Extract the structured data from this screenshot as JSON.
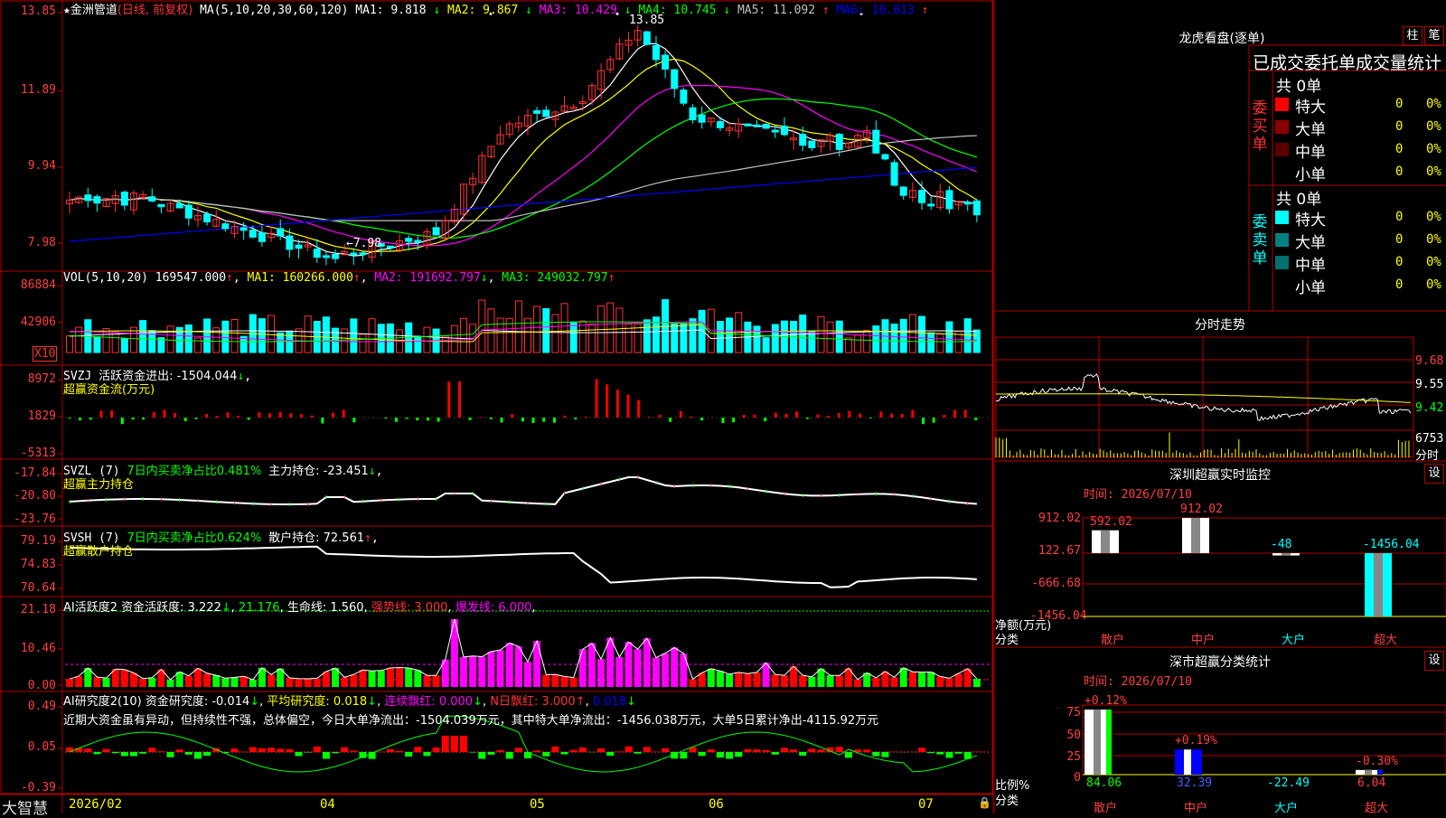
{
  "app": {
    "brand": "大智慧",
    "date_start": "2026/02",
    "months": [
      "04",
      "05",
      "06",
      "07"
    ]
  },
  "colors": {
    "up": "#ff3232",
    "down": "#00ffff",
    "grid": "#b00000",
    "axis_text": "#ff4040",
    "ma1": "#ffffff",
    "ma2": "#ffff00",
    "ma3": "#ff00ff",
    "ma4": "#00ff00",
    "ma5": "#c0c0c0",
    "ma6": "#0000ff"
  },
  "price_panel": {
    "title_star": "★",
    "stock_name": "金洲管道",
    "mode": "(日线, 前复权)",
    "ma_params": "MA(5,10,20,30,60,120)",
    "ma_values": [
      {
        "label": "MA1: 9.818",
        "arrow": "↓",
        "color": "#ffffff"
      },
      {
        "label": "MA2: 9.867",
        "arrow": "↓",
        "color": "#ffff00"
      },
      {
        "label": "MA3: 10.429",
        "arrow": "↓",
        "color": "#ff00ff"
      },
      {
        "label": "MA4: 10.745",
        "arrow": "↓",
        "color": "#00ff00"
      },
      {
        "label": "MA5: 11.092",
        "arrow": "↑",
        "color": "#c0c0c0"
      },
      {
        "label": "MA6: 10.013",
        "arrow": "↑",
        "color": "#0000ff"
      }
    ],
    "y_ticks": [
      "13.85",
      "11.89",
      "9.94",
      "7.98"
    ],
    "high_label": "13.85",
    "low_label": "←7.98"
  },
  "vol_panel": {
    "title": "VOL(5,10,20)",
    "value": "169547.000",
    "arrow": "↑",
    "ma1": "MA1: 160266.000",
    "ma1_arrow": "↑",
    "ma2": "MA2: 191692.797",
    "ma2_arrow": "↓",
    "ma3": "MA3: 249032.797",
    "ma3_arrow": "↑",
    "y_ticks": [
      "86884",
      "42906"
    ],
    "unit": "X10"
  },
  "svzj_panel": {
    "title": "SVZJ",
    "label": "活跃资金进出: -1504.044",
    "arrow": "↓",
    "subtitle": "超赢资金流(万元)",
    "y_ticks": [
      "8972",
      "1829",
      "-5313"
    ]
  },
  "svzl_panel": {
    "title": "SVZL (7)",
    "green_text": "7日内买卖净占比0.481%",
    "label": "主力持仓: -23.451",
    "arrow": "↓",
    "subtitle": "超赢主力持仓",
    "y_ticks": [
      "-17.84",
      "-20.80",
      "-23.76"
    ]
  },
  "svsh_panel": {
    "title": "SVSH (7)",
    "green_text": "7日内买卖净占比0.624%",
    "label": "散户持仓: 72.561",
    "arrow": "↑",
    "subtitle": "超赢散户持仓",
    "y_ticks": [
      "79.19",
      "74.83",
      "70.64"
    ]
  },
  "ai_active_panel": {
    "title": "AI活跃度2",
    "label": "资金活跃度: 3.222",
    "arrow": "↓",
    "second": "21.176",
    "life": "生命线: 1.560",
    "strong": "强势线: 3.000",
    "burst": "爆发线: 6.000",
    "y_ticks": [
      "21.18",
      "10.46",
      "0.00"
    ]
  },
  "ai_research_panel": {
    "title": "AI研究度2(10)",
    "label": "资金研究度: -0.014",
    "arrow": "↓",
    "avg": "平均研究度: 0.018",
    "cont": "连续飘红: 0.000",
    "nday": "N日飘红: 3.000",
    "last": "0.018",
    "comment": "近期大资金虽有异动，但持续性不强，总体偏空，今日大单净流出：-1504.039万元，其中特大单净流出：-1456.038万元，大单5日累计净出-4115.92万元",
    "y_ticks": [
      "0.49",
      "0.05",
      "-0.39"
    ]
  },
  "dragon": {
    "title": "龙虎看盘(逐单)",
    "btn_bar": "柱",
    "btn_pen": "笔",
    "header": "已成交委托单成交量统计",
    "buy_label": "委买单",
    "sell_label": "委卖单",
    "buy_total": "共 0单",
    "sell_total": "共 0单",
    "rows": [
      "特大",
      "大单",
      "中单",
      "小单"
    ],
    "zero": "0",
    "pct": "0%",
    "buy_colors": [
      "#ff0000",
      "#8b0000",
      "#5a0000",
      ""
    ],
    "sell_colors": [
      "#00ffff",
      "#008080",
      "#007070",
      ""
    ]
  },
  "intraday": {
    "title": "分时走势",
    "y_ticks": [
      "9.68",
      "9.55",
      "9.42"
    ],
    "vol_tick": "6753",
    "unit": "分时"
  },
  "sz_monitor": {
    "title": "深圳超赢实时监控",
    "set_btn": "设",
    "time": "时间: 2026/07/10",
    "y_ticks": [
      "912.02",
      "122.67",
      "-666.68",
      "-1456.04"
    ],
    "y_unit": "净额(万元)",
    "x_unit": "分类",
    "categories": [
      "散户",
      "中户",
      "大户",
      "超大"
    ],
    "values": [
      592.02,
      912.02,
      -48,
      -1456.04
    ],
    "value_labels": [
      "592.02",
      "912.02",
      "-48",
      "-1456.04"
    ]
  },
  "sz_class": {
    "title": "深市超赢分类统计",
    "set_btn": "设",
    "time": "时间: 2026/07/10",
    "y_ticks": [
      "75",
      "50",
      "25",
      "0"
    ],
    "y_unit": "比例%",
    "x_unit": "分类",
    "categories": [
      "散户",
      "中户",
      "大户",
      "超大"
    ],
    "ratios": [
      84.06,
      32.39,
      -22.49,
      6.04
    ],
    "ratio_labels": [
      "84.06",
      "32.39",
      "-22.49",
      "6.04"
    ],
    "changes": [
      "+0.12%",
      "+0.19%",
      "",
      "-0.30%"
    ]
  }
}
